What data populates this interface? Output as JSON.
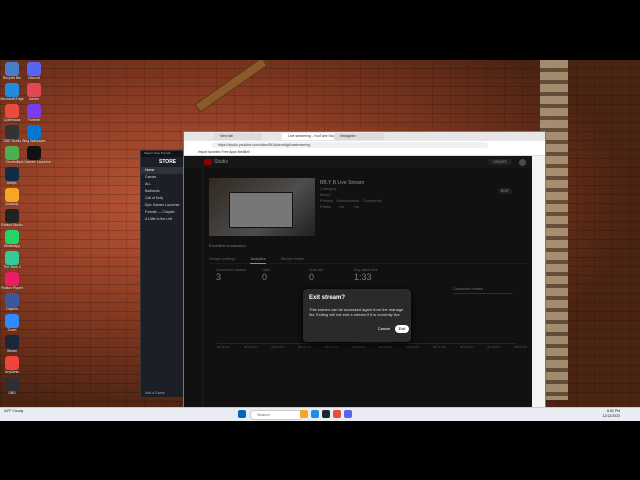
{
  "desktop_icons": [
    {
      "label": "Recycle Bin",
      "color": "#4a7ec7"
    },
    {
      "label": "Microsoft Edge",
      "color": "#1f8ce0"
    },
    {
      "label": "Cyberduck",
      "color": "#e84c3d"
    },
    {
      "label": "OBS Studio",
      "color": "#333"
    },
    {
      "label": "Shortcut",
      "color": "#4caf50"
    },
    {
      "label": "DeepL",
      "color": "#0f2b46"
    },
    {
      "label": "Audacity",
      "color": "#f5a623"
    },
    {
      "label": "Roblox Studio",
      "color": "#222"
    },
    {
      "label": "WhatsApp",
      "color": "#25d366"
    },
    {
      "label": "The Sims 4",
      "color": "#3c9"
    },
    {
      "label": "Roblox Player",
      "color": "#e91e63"
    },
    {
      "label": "Dolphin",
      "color": "#3b5998"
    },
    {
      "label": "Zoom",
      "color": "#2d8cff"
    },
    {
      "label": "Steam",
      "color": "#1b2838"
    },
    {
      "label": "AnyDesk",
      "color": "#ef443b"
    },
    {
      "label": "OBS",
      "color": "#302e31"
    },
    {
      "label": "Discord",
      "color": "#5865f2"
    },
    {
      "label": "Adobe",
      "color": "#e34850"
    },
    {
      "label": "Fortnite",
      "color": "#7a3cf0"
    },
    {
      "label": "Bing Wallpaper",
      "color": "#0078d4"
    },
    {
      "label": "Epic Games Launcher",
      "color": "#111"
    }
  ],
  "store": {
    "menu": "Steam  View  Friends",
    "title": "STORE",
    "items": [
      "Home",
      "Games",
      "ALL",
      "Badlands",
      "Call of Duty",
      "Epic Games Launcher",
      "Fortnite — Chapter",
      "A Little to the Left"
    ],
    "footer": "Add a Game"
  },
  "browser": {
    "tabs": [
      "New tab",
      "Live streaming - YouTube Studio",
      "Instagram"
    ],
    "url": "https://studio.youtube.com/video/Bi1kkdrmdlg/livestreaming",
    "bookmarks": "Import favorites   Free Apps   MedBell"
  },
  "studio": {
    "brand": "Studio",
    "create": "CREATE",
    "stream_title": "BB.Y B Live Stream",
    "category_label": "Category",
    "category": "Music",
    "privacy_label": "Privacy",
    "privacy": "Public",
    "monetization_label": "Monetization",
    "monetization": "On",
    "comments_label": "Comments",
    "comments": "On",
    "edit": "EDIT",
    "connection": "Excellent connection",
    "tabs": [
      "Stream settings",
      "Analytics",
      "Stream health"
    ],
    "stats": [
      {
        "label": "Concurrent viewers",
        "value": "3"
      },
      {
        "label": "Likes",
        "value": "0"
      },
      {
        "label": "Chat rate",
        "value": "0"
      },
      {
        "label": "Avg watch time",
        "value": "1:33"
      }
    ],
    "dropdown": "Concurrent viewers",
    "chart_y_ticks": [
      "3",
      "2",
      "1",
      "0"
    ],
    "chart_x_ticks": [
      "08:39 PM",
      "08:40 PM",
      "08:41 PM",
      "08:42 PM",
      "08:43 PM",
      "08:44 PM",
      "08:45 PM",
      "08:46 PM",
      "08:47 PM",
      "08:48 PM",
      "08:49 PM",
      "08:50 PM"
    ]
  },
  "dialog": {
    "title": "Exit stream?",
    "body": "This stream can be accessed again from the manage list. Exiting will not end a stream if it is currently live.",
    "cancel": "Cancel",
    "exit": "Exit"
  },
  "taskbar": {
    "weather": "34°F  Cloudy",
    "search": "Search",
    "time": "8:52 PM",
    "date": "12/12/2023"
  }
}
